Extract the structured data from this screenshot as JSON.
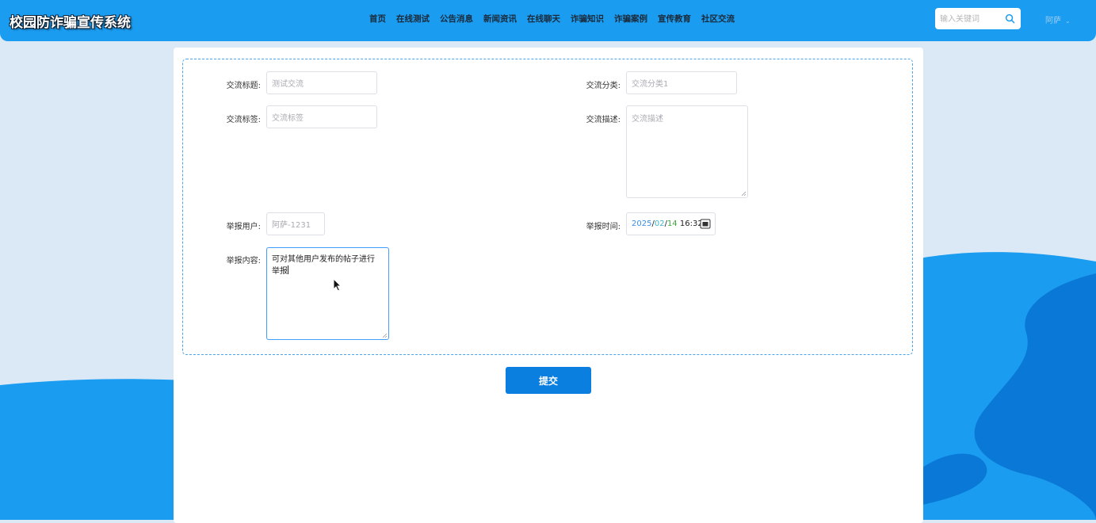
{
  "header": {
    "logo": "校园防诈骗宣传系统",
    "nav": [
      "首页",
      "在线测试",
      "公告消息",
      "新闻资讯",
      "在线聊天",
      "诈骗知识",
      "诈骗案例",
      "宣传教育",
      "社区交流"
    ],
    "search_placeholder": "输入关键词",
    "user": "阿萨"
  },
  "form": {
    "title_label": "交流标题:",
    "title_value": "测试交流",
    "category_label": "交流分类:",
    "category_value": "交流分类1",
    "tags_label": "交流标签:",
    "tags_placeholder": "交流标签",
    "desc_label": "交流描述:",
    "desc_placeholder": "交流描述",
    "report_user_label": "举报用户:",
    "report_user_value": "阿萨-1231",
    "report_time_label": "举报时间:",
    "report_time": {
      "year": "2025",
      "month": "02",
      "day": "14",
      "time": "16:32"
    },
    "report_content_label": "举报内容:",
    "report_content_line1": "可对其他用户发布的帖子进行",
    "report_content_line2": "举报",
    "submit_label": "提交"
  },
  "colors": {
    "header_bg": "#1a9cf0",
    "accent": "#0b7fe0",
    "page_bg": "#dbe9f7"
  }
}
